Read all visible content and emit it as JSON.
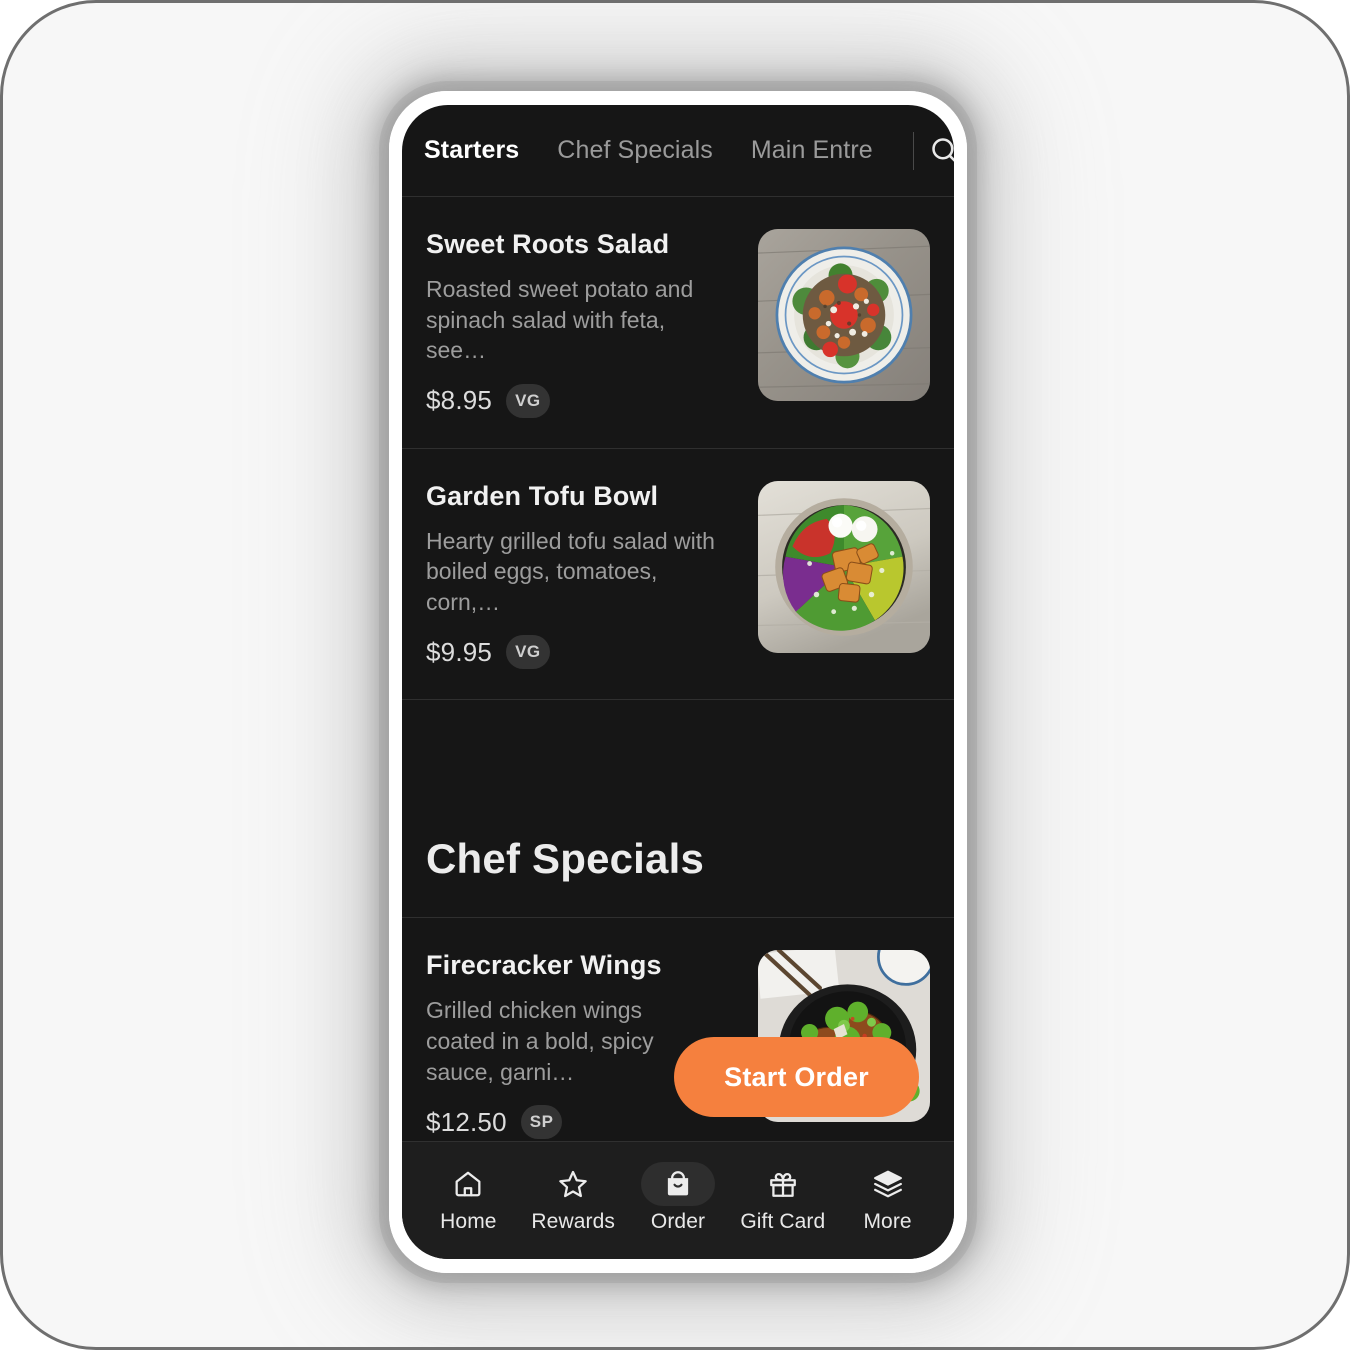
{
  "topbar": {
    "tabs": [
      {
        "label": "Starters",
        "active": true
      },
      {
        "label": "Chef Specials",
        "active": false
      },
      {
        "label": "Main Entre",
        "active": false
      }
    ],
    "search_icon": "search-icon"
  },
  "sections": [
    {
      "items": [
        {
          "name": "Sweet Roots Salad",
          "description": "Roasted sweet potato and spinach salad with feta, see…",
          "price": "$8.95",
          "badge": "VG",
          "image": "sweet-roots-salad-photo"
        },
        {
          "name": "Garden Tofu Bowl",
          "description": "Hearty grilled tofu salad with boiled eggs, tomatoes, corn,…",
          "price": "$9.95",
          "badge": "VG",
          "image": "garden-tofu-bowl-photo"
        }
      ]
    },
    {
      "title": "Chef Specials",
      "items": [
        {
          "name": "Firecracker Wings",
          "description": "Grilled chicken wings coated in a bold, spicy sauce, garni…",
          "price": "$12.50",
          "badge": "SP",
          "image": "firecracker-wings-photo"
        }
      ]
    }
  ],
  "cta": {
    "label": "Start Order"
  },
  "bottom_nav": {
    "items": [
      {
        "label": "Home",
        "icon": "home-icon",
        "active": false
      },
      {
        "label": "Rewards",
        "icon": "star-icon",
        "active": false
      },
      {
        "label": "Order",
        "icon": "shopping-bag-icon",
        "active": true
      },
      {
        "label": "Gift Card",
        "icon": "gift-icon",
        "active": false
      },
      {
        "label": "More",
        "icon": "layers-icon",
        "active": false
      }
    ]
  },
  "colors": {
    "accent": "#f5803e",
    "screen_bg": "#161616",
    "nav_bg": "#1e1e1e",
    "badge_bg": "#333333",
    "divider": "#2f2f2f"
  }
}
